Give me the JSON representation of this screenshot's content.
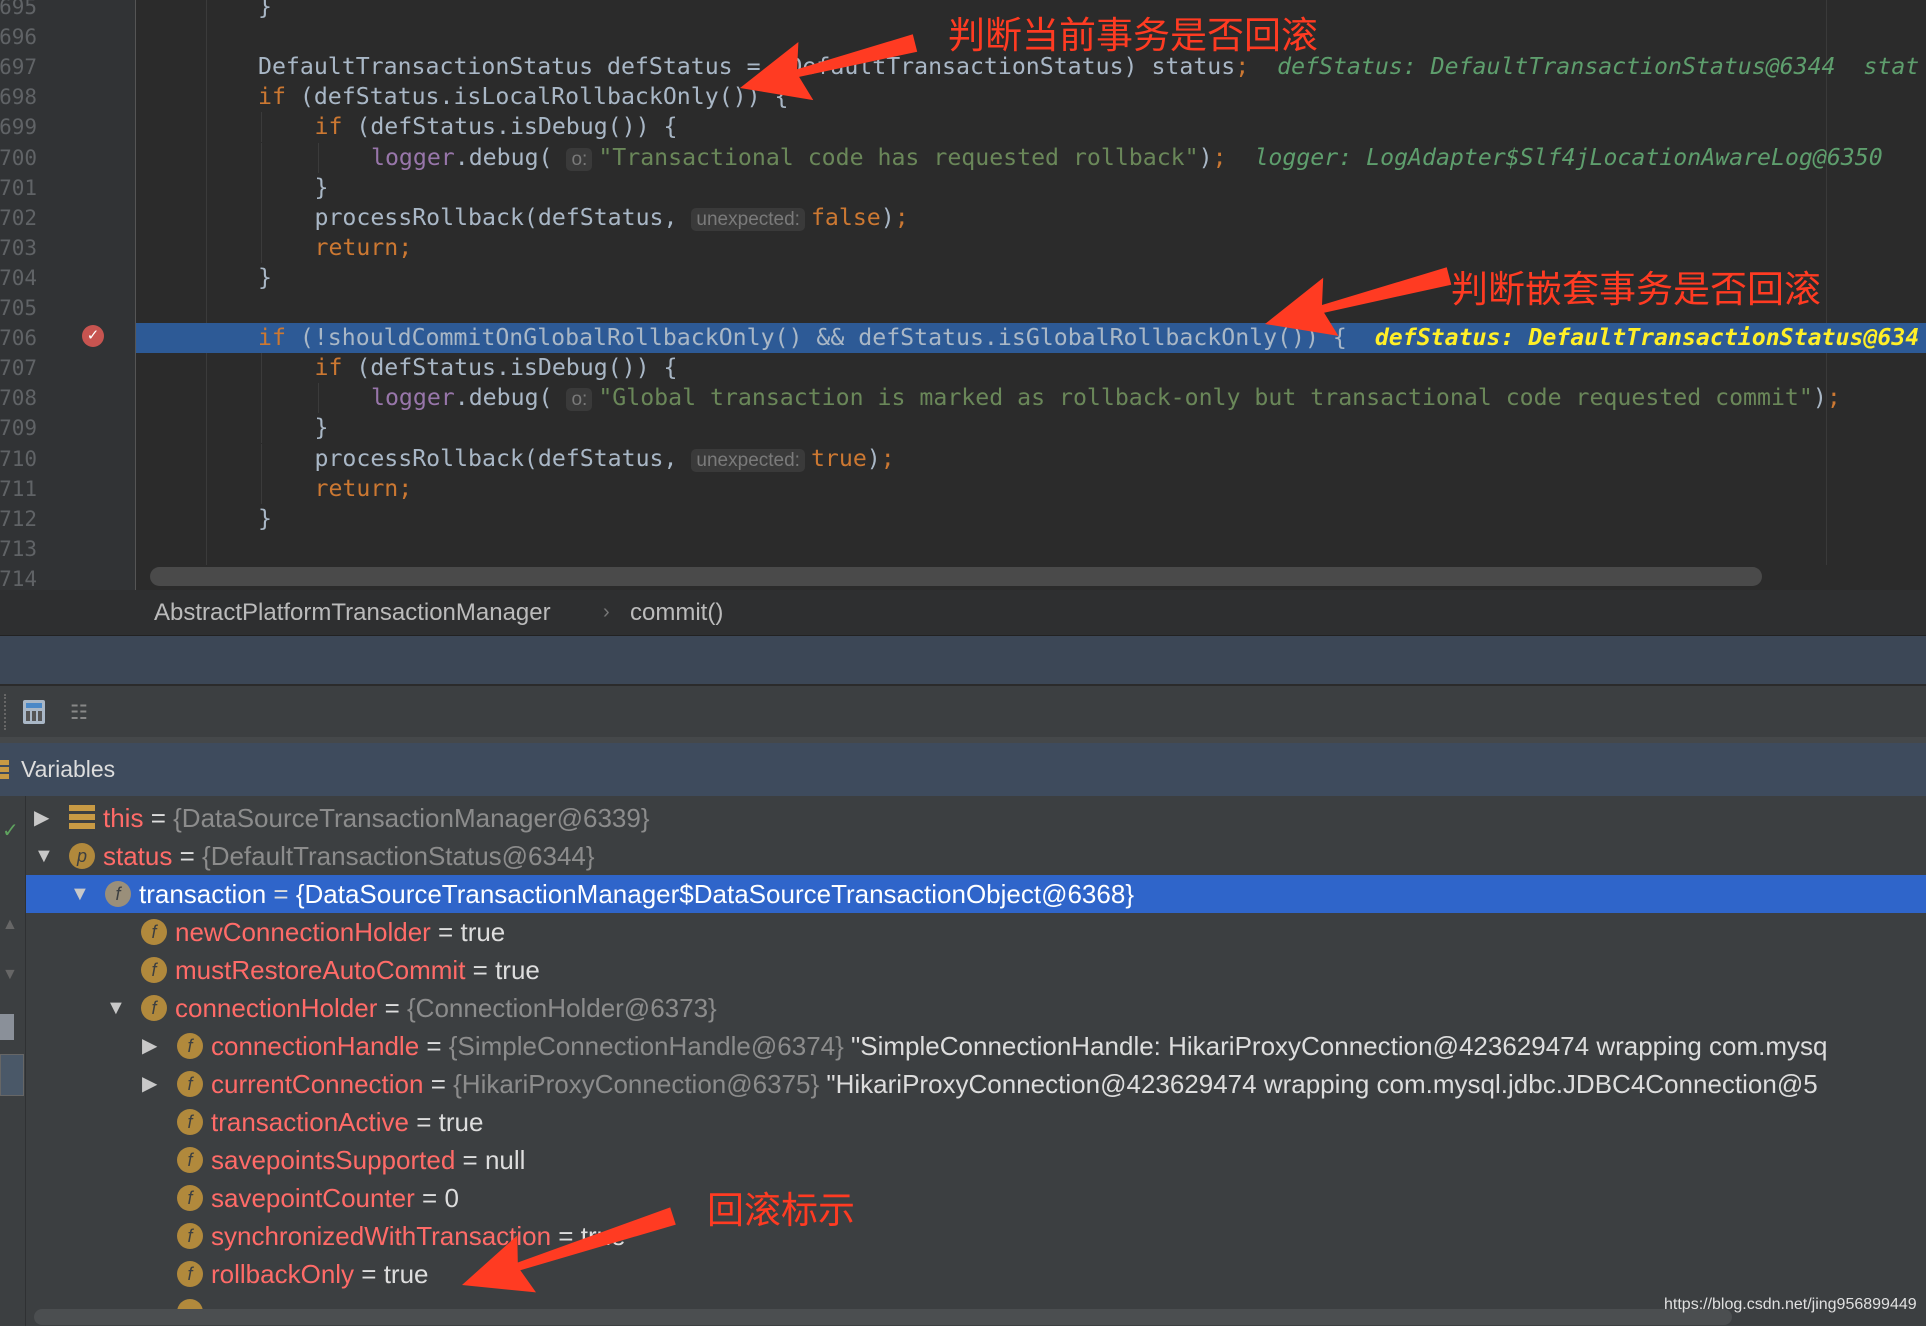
{
  "editor": {
    "line_numbers": [
      "695",
      "696",
      "697",
      "698",
      "699",
      "700",
      "701",
      "702",
      "703",
      "704",
      "705",
      "706",
      "707",
      "708",
      "709",
      "710",
      "711",
      "712",
      "713",
      "714"
    ],
    "current_line": "706",
    "lines": [
      {
        "n": "695",
        "indent": 0,
        "tokens": [
          {
            "t": "}",
            "c": "id"
          }
        ]
      },
      {
        "n": "696",
        "indent": 0,
        "tokens": []
      },
      {
        "n": "697",
        "indent": 0,
        "tokens": [
          {
            "t": "DefaultTransactionStatus defStatus = (DefaultTransactionStatus) status",
            "c": "id"
          },
          {
            "t": ";",
            "c": "punc"
          },
          {
            "t": "  defStatus: DefaultTransactionStatus@6344  stat",
            "c": "hint"
          }
        ]
      },
      {
        "n": "698",
        "indent": 0,
        "tokens": [
          {
            "t": "if ",
            "c": "kw"
          },
          {
            "t": "(defStatus.isLocalRollbackOnly()) {",
            "c": "id"
          }
        ]
      },
      {
        "n": "699",
        "indent": 1,
        "tokens": [
          {
            "t": "if ",
            "c": "kw"
          },
          {
            "t": "(defStatus.isDebug()) {",
            "c": "id"
          }
        ]
      },
      {
        "n": "700",
        "indent": 2,
        "tokens": [
          {
            "t": "logger",
            "c": "fld"
          },
          {
            "t": ".debug( ",
            "c": "id"
          },
          {
            "t": "o:",
            "c": "phint"
          },
          {
            "t": "\"Transactional code has requested rollback\"",
            "c": "str"
          },
          {
            "t": ")",
            "c": "id"
          },
          {
            "t": ";",
            "c": "punc"
          },
          {
            "t": "  logger: LogAdapter$Slf4jLocationAwareLog@6350",
            "c": "hint"
          }
        ]
      },
      {
        "n": "701",
        "indent": 1,
        "tokens": [
          {
            "t": "}",
            "c": "id"
          }
        ]
      },
      {
        "n": "702",
        "indent": 1,
        "tokens": [
          {
            "t": "processRollback(defStatus, ",
            "c": "id"
          },
          {
            "t": "unexpected:",
            "c": "phint"
          },
          {
            "t": "false",
            "c": "kw"
          },
          {
            "t": ")",
            "c": "id"
          },
          {
            "t": ";",
            "c": "punc"
          }
        ]
      },
      {
        "n": "703",
        "indent": 1,
        "tokens": [
          {
            "t": "return;",
            "c": "kw"
          }
        ]
      },
      {
        "n": "704",
        "indent": 0,
        "tokens": [
          {
            "t": "}",
            "c": "id"
          }
        ]
      },
      {
        "n": "705",
        "indent": 0,
        "tokens": []
      },
      {
        "n": "706",
        "indent": 0,
        "tokens": [
          {
            "t": "if ",
            "c": "kw"
          },
          {
            "t": "(!shouldCommitOnGlobalRollbackOnly() && defStatus.isGlobalRollbackOnly()) {",
            "c": "id"
          },
          {
            "t": "  defStatus: DefaultTransactionStatus@634",
            "c": "hint"
          }
        ]
      },
      {
        "n": "707",
        "indent": 1,
        "tokens": [
          {
            "t": "if ",
            "c": "kw"
          },
          {
            "t": "(defStatus.isDebug()) {",
            "c": "id"
          }
        ]
      },
      {
        "n": "708",
        "indent": 2,
        "tokens": [
          {
            "t": "logger",
            "c": "fld"
          },
          {
            "t": ".debug( ",
            "c": "id"
          },
          {
            "t": "o:",
            "c": "phint"
          },
          {
            "t": "\"Global transaction is marked as rollback-only but transactional code requested commit\"",
            "c": "str"
          },
          {
            "t": ")",
            "c": "id"
          },
          {
            "t": ";",
            "c": "punc"
          }
        ]
      },
      {
        "n": "709",
        "indent": 1,
        "tokens": [
          {
            "t": "}",
            "c": "id"
          }
        ]
      },
      {
        "n": "710",
        "indent": 1,
        "tokens": [
          {
            "t": "processRollback(defStatus, ",
            "c": "id"
          },
          {
            "t": "unexpected:",
            "c": "phint"
          },
          {
            "t": "true",
            "c": "kw"
          },
          {
            "t": ")",
            "c": "id"
          },
          {
            "t": ";",
            "c": "punc"
          }
        ]
      },
      {
        "n": "711",
        "indent": 1,
        "tokens": [
          {
            "t": "return;",
            "c": "kw"
          }
        ]
      },
      {
        "n": "712",
        "indent": 0,
        "tokens": [
          {
            "t": "}",
            "c": "id"
          }
        ]
      },
      {
        "n": "713",
        "indent": 0,
        "tokens": []
      },
      {
        "n": "714",
        "indent": 0,
        "tokens": []
      }
    ]
  },
  "breadcrumb": {
    "class_name": "AbstractPlatformTransactionManager",
    "separator": "›",
    "method": "commit()"
  },
  "variables_panel": {
    "title": "Variables",
    "toolbar_icons": [
      "calculator-icon",
      "restore-layout-icon"
    ],
    "rows": [
      {
        "level": 0,
        "expand": "collapsed",
        "icon": "this",
        "name": "this",
        "value": "{DataSourceTransactionManager@6339}",
        "value_type": "obj"
      },
      {
        "level": 0,
        "expand": "expanded",
        "icon": "p",
        "name": "status",
        "value": "{DefaultTransactionStatus@6344}",
        "value_type": "obj"
      },
      {
        "level": 1,
        "expand": "expanded",
        "icon": "f",
        "name": "transaction",
        "value": "{DataSourceTransactionManager$DataSourceTransactionObject@6368}",
        "value_type": "obj",
        "selected": true
      },
      {
        "level": 2,
        "expand": "none",
        "icon": "f",
        "name": "newConnectionHolder",
        "value": "true",
        "value_type": "prim"
      },
      {
        "level": 2,
        "expand": "none",
        "icon": "f",
        "name": "mustRestoreAutoCommit",
        "value": "true",
        "value_type": "prim"
      },
      {
        "level": 2,
        "expand": "expanded",
        "icon": "f",
        "name": "connectionHolder",
        "value": "{ConnectionHolder@6373}",
        "value_type": "obj"
      },
      {
        "level": 3,
        "expand": "collapsed",
        "icon": "f",
        "name": "connectionHandle",
        "value": "{SimpleConnectionHandle@6374}",
        "value_type": "obj",
        "extra": "\"SimpleConnectionHandle: HikariProxyConnection@423629474 wrapping com.mysq"
      },
      {
        "level": 3,
        "expand": "collapsed",
        "icon": "f",
        "name": "currentConnection",
        "value": "{HikariProxyConnection@6375}",
        "value_type": "obj",
        "extra": "\"HikariProxyConnection@423629474 wrapping com.mysql.jdbc.JDBC4Connection@5"
      },
      {
        "level": 3,
        "expand": "none",
        "icon": "f",
        "name": "transactionActive",
        "value": "true",
        "value_type": "prim"
      },
      {
        "level": 3,
        "expand": "none",
        "icon": "f",
        "name": "savepointsSupported",
        "value": "null",
        "value_type": "prim"
      },
      {
        "level": 3,
        "expand": "none",
        "icon": "f",
        "name": "savepointCounter",
        "value": "0",
        "value_type": "prim"
      },
      {
        "level": 3,
        "expand": "none",
        "icon": "f",
        "name": "synchronizedWithTransaction",
        "value": "true",
        "value_type": "prim"
      },
      {
        "level": 3,
        "expand": "none",
        "icon": "f",
        "name": "rollbackOnly",
        "value": "true",
        "value_type": "prim"
      }
    ]
  },
  "annotations": {
    "local_rollback": "判断当前事务是否回滚",
    "global_rollback": "判断嵌套事务是否回滚",
    "rollback_flag": "回滚标示",
    "color": "#ff3b22"
  },
  "watermark": "https://blog.csdn.net/jing956899449",
  "colors": {
    "keyword": "#cc7832",
    "string": "#6a8759",
    "field": "#9876aa",
    "current_line": "#2d5a96",
    "selected_row": "#2f65ca",
    "variable_name": "#ff6b68"
  }
}
